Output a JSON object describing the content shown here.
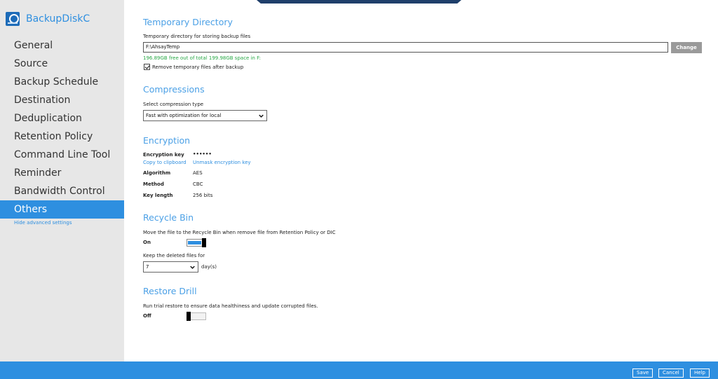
{
  "sidebar": {
    "title": "BackupDiskC",
    "logo_icon": "backup-set-logo-icon",
    "items": [
      {
        "label": "General"
      },
      {
        "label": "Source"
      },
      {
        "label": "Backup Schedule"
      },
      {
        "label": "Destination"
      },
      {
        "label": "Deduplication"
      },
      {
        "label": "Retention Policy"
      },
      {
        "label": "Command Line Tool"
      },
      {
        "label": "Reminder"
      },
      {
        "label": "Bandwidth Control"
      },
      {
        "label": "Others",
        "active": true
      }
    ],
    "hide_advanced": "Hide advanced settings"
  },
  "temp_dir": {
    "title": "Temporary Directory",
    "label": "Temporary directory for storing backup files",
    "value": "F:\\AhsayTemp",
    "change_label": "Change",
    "free_space": "196.89GB free out of total 199.98GB space in F:",
    "remove_label": "Remove temporary files after backup",
    "remove_checked": true
  },
  "compressions": {
    "title": "Compressions",
    "label": "Select compression type",
    "selected": "Fast with optimization for local"
  },
  "encryption": {
    "title": "Encryption",
    "key_label": "Encryption key",
    "key_value": "••••••",
    "copy_label": "Copy to clipboard",
    "unmask_label": "Unmask encryption key",
    "algorithm_label": "Algorithm",
    "algorithm_value": "AES",
    "method_label": "Method",
    "method_value": "CBC",
    "key_length_label": "Key length",
    "key_length_value": "256 bits"
  },
  "recycle_bin": {
    "title": "Recycle Bin",
    "description": "Move the file to the Recycle Bin when remove file from Retention Policy or DIC",
    "state": "On",
    "keep_label": "Keep the deleted files for",
    "keep_value": "7",
    "unit": "day(s)"
  },
  "restore_drill": {
    "title": "Restore Drill",
    "description": "Run trial restore to ensure data healthiness and update corrupted files.",
    "state": "Off"
  },
  "footer": {
    "save": "Save",
    "cancel": "Cancel",
    "help": "Help"
  },
  "colors": {
    "accent": "#2e8fe0",
    "section_title": "#4ba0e6",
    "success": "#28a745",
    "sidebar_bg": "#e7e7e7"
  }
}
